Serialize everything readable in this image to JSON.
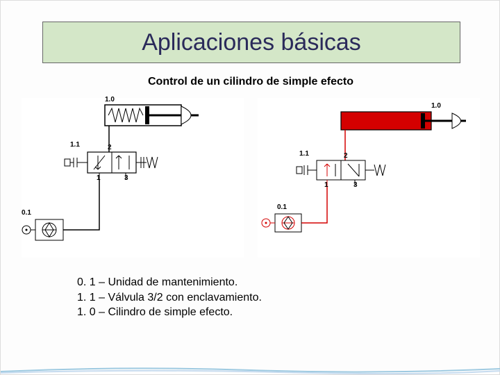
{
  "title": "Aplicaciones básicas",
  "subtitle": "Control de un cilindro de simple efecto",
  "legend": {
    "line1": "0. 1 – Unidad de mantenimiento.",
    "line2": "1. 1 – Válvula 3/2 con enclavamiento.",
    "line3": "1. 0 – Cilindro de simple efecto."
  },
  "diagram_left": {
    "labels": {
      "cylinder": "1.0",
      "valve": "1.1",
      "source": "0.1",
      "port2": "2",
      "port1": "1",
      "port3": "3"
    },
    "state": "rest",
    "line_color": "#000000",
    "cylinder_fill": "#ffffff"
  },
  "diagram_right": {
    "labels": {
      "cylinder": "1.0",
      "valve": "1.1",
      "source": "0.1",
      "port2": "2",
      "port1": "1",
      "port3": "3"
    },
    "state": "actuated",
    "line_color": "#d40000",
    "cylinder_fill": "#d40000"
  }
}
